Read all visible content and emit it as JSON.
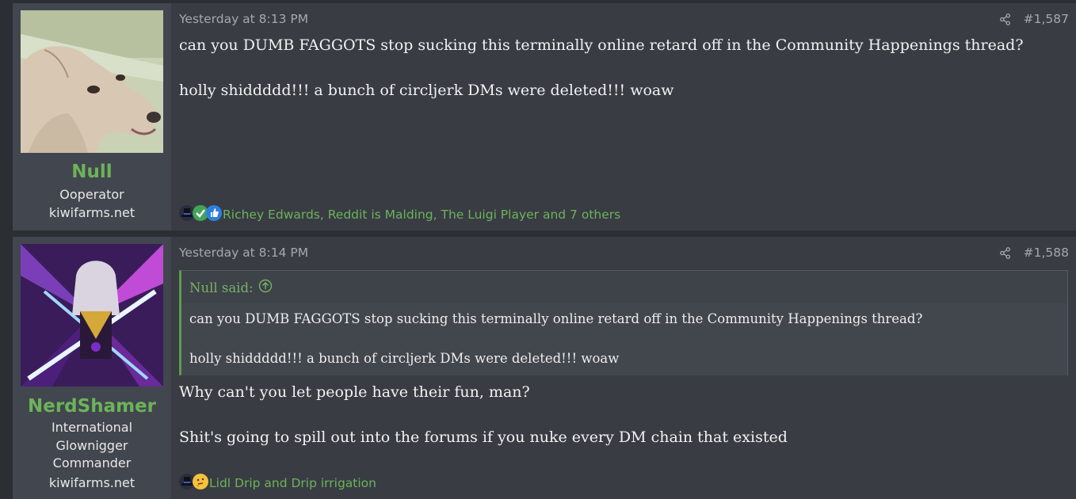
{
  "posts": [
    {
      "user": {
        "name": "Null",
        "title_lines": [
          "Ooperator"
        ],
        "site": "kiwifarms.net"
      },
      "date": "Yesterday at 8:13 PM",
      "number": "#1,587",
      "body": [
        "can you DUMB FAGGOTS stop sucking this terminally online retard off in the Community Happenings thread?",
        "holly shiddddd!!! a bunch of circljerk DMs were deleted!!! woaw"
      ],
      "reactions": {
        "icons": [
          "top-hat-icon",
          "checkmark-icon",
          "thumbs-up-icon"
        ],
        "text": "Richey Edwards, Reddit is Malding, The Luigi Player and 7 others"
      }
    },
    {
      "user": {
        "name": "NerdShamer",
        "title_lines": [
          "International",
          "Glownigger",
          "Commander"
        ],
        "site": "kiwifarms.net"
      },
      "date": "Yesterday at 8:14 PM",
      "number": "#1,588",
      "quote": {
        "author": "Null said:",
        "lines": [
          "can you DUMB FAGGOTS stop sucking this terminally online retard off in the Community Happenings thread?",
          "holly shiddddd!!! a bunch of circljerk DMs were deleted!!! woaw"
        ]
      },
      "body": [
        "Why can't you let people have their fun, man?",
        "Shit's going to spill out into the forums if you nuke every DM chain that existed"
      ],
      "reactions": {
        "icons": [
          "top-hat-icon",
          "thinking-face-icon"
        ],
        "text": "Lidl Drip and Drip irrigation"
      }
    }
  ],
  "colors": {
    "page_bg": "#2b2e33",
    "post_bg": "#393c43",
    "user_col_bg": "#42464e",
    "username": "#6cb35a",
    "meta_text": "#a5a8ad",
    "body_text": "#f2f2f2",
    "quote_border": "#5f9a4f"
  }
}
